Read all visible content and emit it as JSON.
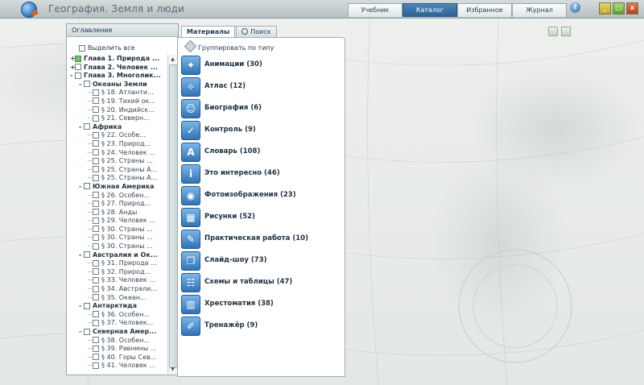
{
  "window": {
    "title": "География. Земля и люди",
    "nav_tabs": [
      {
        "label": "Учебник",
        "active": false
      },
      {
        "label": "Каталог",
        "active": true
      },
      {
        "label": "Избранное",
        "active": false
      },
      {
        "label": "Журнал",
        "active": false
      }
    ],
    "help_glyph": "?",
    "buttons": {
      "minimize": "_",
      "maximize": "□",
      "close": "x"
    }
  },
  "colors": {
    "accent": "#2c5f90",
    "button_blue": "#2f73b5"
  },
  "toc": {
    "header": "Оглавление",
    "select_all": "Выделить все",
    "items": [
      {
        "level": 0,
        "expander": "+",
        "green": true,
        "label": "Глава 1. Природа ..."
      },
      {
        "level": 0,
        "expander": "+",
        "green": false,
        "label": "Глава 2. Человек ..."
      },
      {
        "level": 0,
        "expander": "-",
        "green": false,
        "label": "Глава 3. Многолик..."
      },
      {
        "level": 1,
        "expander": "-",
        "green": false,
        "label": "Океаны Земли"
      },
      {
        "level": 2,
        "label": "§ 18. Атланти..."
      },
      {
        "level": 2,
        "label": "§ 19. Тихий ок..."
      },
      {
        "level": 2,
        "label": "§ 20. Индийск..."
      },
      {
        "level": 2,
        "label": "§ 21. Северн..."
      },
      {
        "level": 1,
        "expander": "-",
        "green": false,
        "label": "Африка"
      },
      {
        "level": 2,
        "label": "§ 22. Особе..."
      },
      {
        "level": 2,
        "label": "§ 23. Природ..."
      },
      {
        "level": 2,
        "label": "§ 24. Человек ..."
      },
      {
        "level": 2,
        "label": "§ 25. Страны ..."
      },
      {
        "level": 2,
        "label": "§ 25. Страны А..."
      },
      {
        "level": 2,
        "label": "§ 25. Страны А..."
      },
      {
        "level": 1,
        "expander": "-",
        "green": false,
        "label": "Южная Америка"
      },
      {
        "level": 2,
        "label": "§ 26. Особен..."
      },
      {
        "level": 2,
        "label": "§ 27. Природ..."
      },
      {
        "level": 2,
        "label": "§ 28. Анды"
      },
      {
        "level": 2,
        "label": "§ 29. Человек ..."
      },
      {
        "level": 2,
        "label": "§ 30. Страны ..."
      },
      {
        "level": 2,
        "label": "§ 30. Страны ..."
      },
      {
        "level": 2,
        "label": "§ 30. Страны ..."
      },
      {
        "level": 1,
        "expander": "-",
        "green": false,
        "label": "Австралия и Ок..."
      },
      {
        "level": 2,
        "label": "§ 31. Природа ..."
      },
      {
        "level": 2,
        "label": "§ 32. Природ..."
      },
      {
        "level": 2,
        "label": "§ 33. Человек ..."
      },
      {
        "level": 2,
        "label": "§ 34. Австрали..."
      },
      {
        "level": 2,
        "label": "§ 35. Океан..."
      },
      {
        "level": 1,
        "expander": "-",
        "green": false,
        "label": "Антарктида"
      },
      {
        "level": 2,
        "label": "§ 36. Особен..."
      },
      {
        "level": 2,
        "label": "§ 37. Человек..."
      },
      {
        "level": 1,
        "expander": "-",
        "green": false,
        "label": "Северная Амер..."
      },
      {
        "level": 2,
        "label": "§ 38. Особен..."
      },
      {
        "level": 2,
        "label": "§ 39. Равнины ..."
      },
      {
        "level": 2,
        "label": "§ 40. Горы Сев..."
      },
      {
        "level": 2,
        "label": "§ 41. Человек ..."
      }
    ]
  },
  "catalog": {
    "tabs": [
      {
        "label": "Материалы",
        "active": true
      },
      {
        "label": "Поиск",
        "active": false
      }
    ],
    "group_by_type": "Группировать по типу",
    "categories": [
      {
        "label": "Анимации (30)",
        "icon": "animation-icon",
        "glyph": "✦"
      },
      {
        "label": "Атлас (12)",
        "icon": "atlas-icon",
        "glyph": "✧"
      },
      {
        "label": "Биография (6)",
        "icon": "person-icon",
        "glyph": "☺"
      },
      {
        "label": "Контроль (9)",
        "icon": "checkmark-icon",
        "glyph": "✓"
      },
      {
        "label": "Словарь (108)",
        "icon": "dictionary-icon",
        "glyph": "A"
      },
      {
        "label": "Это интересно (46)",
        "icon": "info-icon",
        "glyph": "i"
      },
      {
        "label": "Фотоизображения (23)",
        "icon": "camera-icon",
        "glyph": "◉"
      },
      {
        "label": "Рисунки (52)",
        "icon": "picture-icon",
        "glyph": "▦"
      },
      {
        "label": "Практическая работа (10)",
        "icon": "pencil-icon",
        "glyph": "✎"
      },
      {
        "label": "Слайд-шоу (73)",
        "icon": "slideshow-icon",
        "glyph": "❐"
      },
      {
        "label": "Схемы и таблицы (47)",
        "icon": "scheme-icon",
        "glyph": "☷"
      },
      {
        "label": "Хрестоматия (38)",
        "icon": "book-icon",
        "glyph": "▥"
      },
      {
        "label": "Тренажёр (9)",
        "icon": "trainer-icon",
        "glyph": "✐"
      }
    ]
  }
}
